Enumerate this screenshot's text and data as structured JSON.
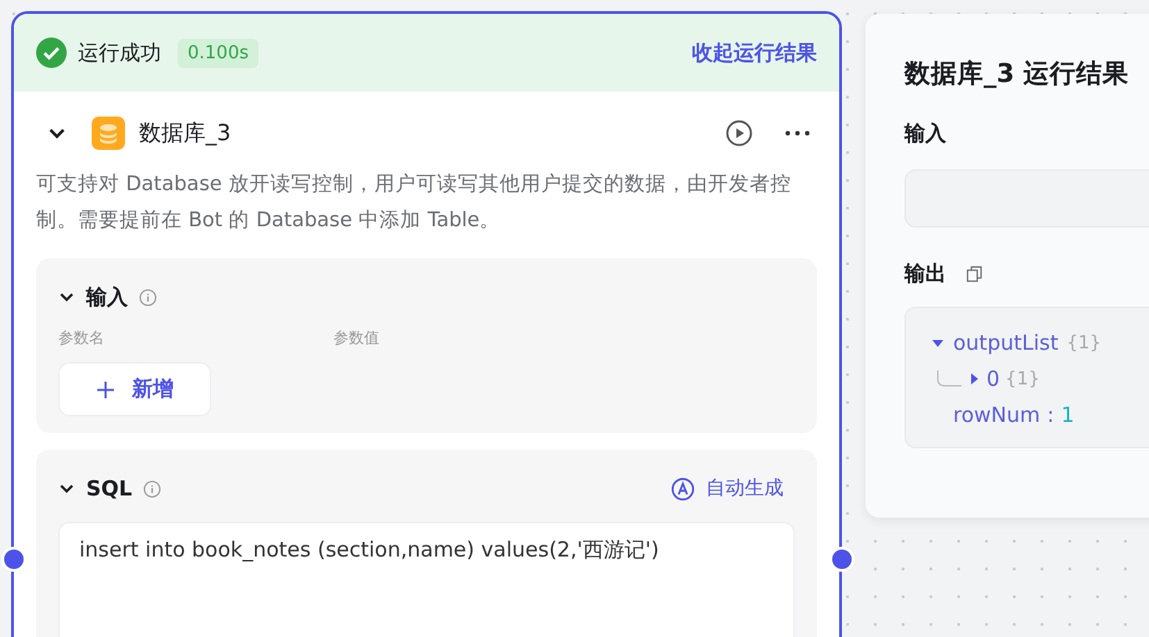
{
  "run_status": {
    "label": "运行成功",
    "duration": "0.100s",
    "collapse_link": "收起运行结果"
  },
  "node": {
    "title": "数据库_3",
    "expanded": true,
    "description": "可支持对 Database 放开读写控制，用户可读写其他用户提交的数据，由开发者控制。需要提前在 Bot 的 Database 中添加 Table。",
    "sections": [
      {
        "kind": "params",
        "title": "输入",
        "expanded": true,
        "columns": [
          "参数名",
          "参数值"
        ],
        "add_button": "新增"
      },
      {
        "kind": "sql",
        "title": "SQL",
        "expanded": true,
        "action": "自动生成",
        "sql": "insert  into book_notes (section,name) values(2,'西游记')"
      }
    ]
  },
  "result_panel": {
    "title": "数据库_3 运行结果",
    "input_label": "输入",
    "output_label": "输出",
    "tree": [
      {
        "key": "outputList",
        "count": "{1}",
        "expanded": true,
        "children": [
          {
            "key": "0",
            "count": "{1}",
            "expanded": false
          }
        ]
      },
      {
        "key": "rowNum",
        "separator": ":",
        "value": "1"
      }
    ]
  }
}
